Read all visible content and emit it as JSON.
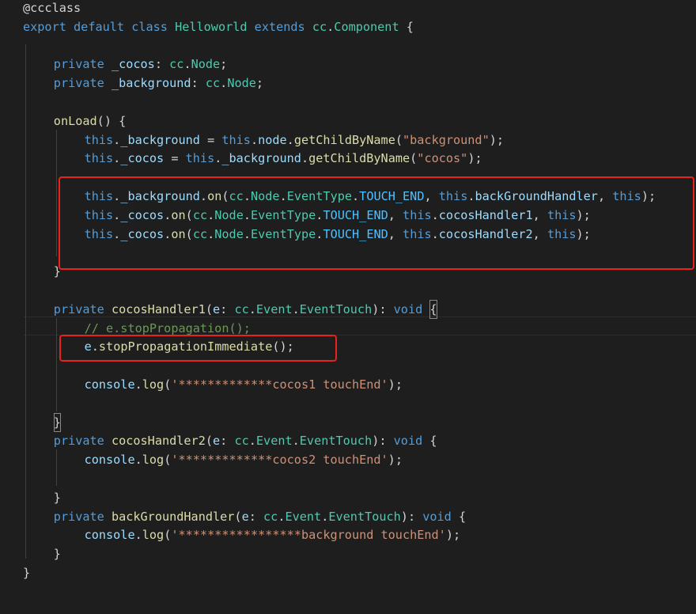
{
  "editor": {
    "lines": [
      {
        "indent": 0,
        "tokens": [
          [
            "@ccclass",
            "t-dec"
          ]
        ]
      },
      {
        "indent": 0,
        "tokens": [
          [
            "export",
            "t-kw"
          ],
          [
            " ",
            "t-punc"
          ],
          [
            "default",
            "t-kw"
          ],
          [
            " ",
            "t-punc"
          ],
          [
            "class",
            "t-kw"
          ],
          [
            " ",
            "t-punc"
          ],
          [
            "Helloworld",
            "t-cls"
          ],
          [
            " ",
            "t-punc"
          ],
          [
            "extends",
            "t-kw"
          ],
          [
            " ",
            "t-punc"
          ],
          [
            "cc",
            "t-cls"
          ],
          [
            ".",
            "t-punc"
          ],
          [
            "Component",
            "t-cls"
          ],
          [
            " {",
            "t-punc"
          ]
        ]
      },
      {
        "indent": 0,
        "tokens": []
      },
      {
        "indent": 1,
        "tokens": [
          [
            "private",
            "t-kw"
          ],
          [
            " ",
            "t-punc"
          ],
          [
            "_cocos",
            "t-prop"
          ],
          [
            ": ",
            "t-punc"
          ],
          [
            "cc",
            "t-cls"
          ],
          [
            ".",
            "t-punc"
          ],
          [
            "Node",
            "t-cls"
          ],
          [
            ";",
            "t-punc"
          ]
        ]
      },
      {
        "indent": 1,
        "tokens": [
          [
            "private",
            "t-kw"
          ],
          [
            " ",
            "t-punc"
          ],
          [
            "_background",
            "t-prop"
          ],
          [
            ": ",
            "t-punc"
          ],
          [
            "cc",
            "t-cls"
          ],
          [
            ".",
            "t-punc"
          ],
          [
            "Node",
            "t-cls"
          ],
          [
            ";",
            "t-punc"
          ]
        ]
      },
      {
        "indent": 0,
        "tokens": []
      },
      {
        "indent": 1,
        "tokens": [
          [
            "onLoad",
            "t-fn"
          ],
          [
            "() {",
            "t-punc"
          ]
        ]
      },
      {
        "indent": 2,
        "tokens": [
          [
            "this",
            "t-kw"
          ],
          [
            ".",
            "t-punc"
          ],
          [
            "_background",
            "t-prop"
          ],
          [
            " = ",
            "t-punc"
          ],
          [
            "this",
            "t-kw"
          ],
          [
            ".",
            "t-punc"
          ],
          [
            "node",
            "t-prop"
          ],
          [
            ".",
            "t-punc"
          ],
          [
            "getChildByName",
            "t-fn"
          ],
          [
            "(",
            "t-punc"
          ],
          [
            "\"background\"",
            "t-str"
          ],
          [
            ");",
            "t-punc"
          ]
        ]
      },
      {
        "indent": 2,
        "tokens": [
          [
            "this",
            "t-kw"
          ],
          [
            ".",
            "t-punc"
          ],
          [
            "_cocos",
            "t-prop"
          ],
          [
            " = ",
            "t-punc"
          ],
          [
            "this",
            "t-kw"
          ],
          [
            ".",
            "t-punc"
          ],
          [
            "_background",
            "t-prop"
          ],
          [
            ".",
            "t-punc"
          ],
          [
            "getChildByName",
            "t-fn"
          ],
          [
            "(",
            "t-punc"
          ],
          [
            "\"cocos\"",
            "t-str"
          ],
          [
            ");",
            "t-punc"
          ]
        ]
      },
      {
        "indent": 0,
        "tokens": []
      },
      {
        "indent": 2,
        "tokens": [
          [
            "this",
            "t-kw"
          ],
          [
            ".",
            "t-punc"
          ],
          [
            "_background",
            "t-prop"
          ],
          [
            ".",
            "t-punc"
          ],
          [
            "on",
            "t-fn"
          ],
          [
            "(",
            "t-punc"
          ],
          [
            "cc",
            "t-cls"
          ],
          [
            ".",
            "t-punc"
          ],
          [
            "Node",
            "t-cls"
          ],
          [
            ".",
            "t-punc"
          ],
          [
            "EventType",
            "t-cls"
          ],
          [
            ".",
            "t-punc"
          ],
          [
            "TOUCH_END",
            "t-const"
          ],
          [
            ", ",
            "t-punc"
          ],
          [
            "this",
            "t-kw"
          ],
          [
            ".",
            "t-punc"
          ],
          [
            "backGroundHandler",
            "t-prop"
          ],
          [
            ", ",
            "t-punc"
          ],
          [
            "this",
            "t-kw"
          ],
          [
            ");",
            "t-punc"
          ]
        ]
      },
      {
        "indent": 2,
        "tokens": [
          [
            "this",
            "t-kw"
          ],
          [
            ".",
            "t-punc"
          ],
          [
            "_cocos",
            "t-prop"
          ],
          [
            ".",
            "t-punc"
          ],
          [
            "on",
            "t-fn"
          ],
          [
            "(",
            "t-punc"
          ],
          [
            "cc",
            "t-cls"
          ],
          [
            ".",
            "t-punc"
          ],
          [
            "Node",
            "t-cls"
          ],
          [
            ".",
            "t-punc"
          ],
          [
            "EventType",
            "t-cls"
          ],
          [
            ".",
            "t-punc"
          ],
          [
            "TOUCH_END",
            "t-const"
          ],
          [
            ", ",
            "t-punc"
          ],
          [
            "this",
            "t-kw"
          ],
          [
            ".",
            "t-punc"
          ],
          [
            "cocosHandler1",
            "t-prop"
          ],
          [
            ", ",
            "t-punc"
          ],
          [
            "this",
            "t-kw"
          ],
          [
            ");",
            "t-punc"
          ]
        ]
      },
      {
        "indent": 2,
        "tokens": [
          [
            "this",
            "t-kw"
          ],
          [
            ".",
            "t-punc"
          ],
          [
            "_cocos",
            "t-prop"
          ],
          [
            ".",
            "t-punc"
          ],
          [
            "on",
            "t-fn"
          ],
          [
            "(",
            "t-punc"
          ],
          [
            "cc",
            "t-cls"
          ],
          [
            ".",
            "t-punc"
          ],
          [
            "Node",
            "t-cls"
          ],
          [
            ".",
            "t-punc"
          ],
          [
            "EventType",
            "t-cls"
          ],
          [
            ".",
            "t-punc"
          ],
          [
            "TOUCH_END",
            "t-const"
          ],
          [
            ", ",
            "t-punc"
          ],
          [
            "this",
            "t-kw"
          ],
          [
            ".",
            "t-punc"
          ],
          [
            "cocosHandler2",
            "t-prop"
          ],
          [
            ", ",
            "t-punc"
          ],
          [
            "this",
            "t-kw"
          ],
          [
            ");",
            "t-punc"
          ]
        ]
      },
      {
        "indent": 0,
        "tokens": []
      },
      {
        "indent": 1,
        "tokens": [
          [
            "}",
            "t-punc"
          ]
        ]
      },
      {
        "indent": 0,
        "tokens": []
      },
      {
        "indent": 1,
        "tokens": [
          [
            "private",
            "t-kw"
          ],
          [
            " ",
            "t-punc"
          ],
          [
            "cocosHandler1",
            "t-fn"
          ],
          [
            "(",
            "t-punc"
          ],
          [
            "e",
            "t-prop"
          ],
          [
            ": ",
            "t-punc"
          ],
          [
            "cc",
            "t-cls"
          ],
          [
            ".",
            "t-punc"
          ],
          [
            "Event",
            "t-cls"
          ],
          [
            ".",
            "t-punc"
          ],
          [
            "EventTouch",
            "t-cls"
          ],
          [
            "): ",
            "t-punc"
          ],
          [
            "void",
            "t-kw"
          ],
          [
            " ",
            "t-punc"
          ],
          [
            "{",
            "t-punc box"
          ]
        ]
      },
      {
        "indent": 2,
        "tokens": [
          [
            "// e.stopPropagation();",
            "t-cm"
          ]
        ]
      },
      {
        "indent": 2,
        "tokens": [
          [
            "e",
            "t-prop"
          ],
          [
            ".",
            "t-punc"
          ],
          [
            "stopPropagationImmediate",
            "t-fn"
          ],
          [
            "();",
            "t-punc"
          ]
        ]
      },
      {
        "indent": 0,
        "tokens": []
      },
      {
        "indent": 2,
        "tokens": [
          [
            "console",
            "t-prop"
          ],
          [
            ".",
            "t-punc"
          ],
          [
            "log",
            "t-fn"
          ],
          [
            "(",
            "t-punc"
          ],
          [
            "'*************cocos1 touchEnd'",
            "t-str"
          ],
          [
            ");",
            "t-punc"
          ]
        ]
      },
      {
        "indent": 0,
        "tokens": []
      },
      {
        "indent": 1,
        "tokens": [
          [
            "}",
            "t-punc box"
          ]
        ]
      },
      {
        "indent": 1,
        "tokens": [
          [
            "private",
            "t-kw"
          ],
          [
            " ",
            "t-punc"
          ],
          [
            "cocosHandler2",
            "t-fn"
          ],
          [
            "(",
            "t-punc"
          ],
          [
            "e",
            "t-prop"
          ],
          [
            ": ",
            "t-punc"
          ],
          [
            "cc",
            "t-cls"
          ],
          [
            ".",
            "t-punc"
          ],
          [
            "Event",
            "t-cls"
          ],
          [
            ".",
            "t-punc"
          ],
          [
            "EventTouch",
            "t-cls"
          ],
          [
            "): ",
            "t-punc"
          ],
          [
            "void",
            "t-kw"
          ],
          [
            " {",
            "t-punc"
          ]
        ]
      },
      {
        "indent": 2,
        "tokens": [
          [
            "console",
            "t-prop"
          ],
          [
            ".",
            "t-punc"
          ],
          [
            "log",
            "t-fn"
          ],
          [
            "(",
            "t-punc"
          ],
          [
            "'*************cocos2 touchEnd'",
            "t-str"
          ],
          [
            ");",
            "t-punc"
          ]
        ]
      },
      {
        "indent": 0,
        "tokens": []
      },
      {
        "indent": 1,
        "tokens": [
          [
            "}",
            "t-punc"
          ]
        ]
      },
      {
        "indent": 1,
        "tokens": [
          [
            "private",
            "t-kw"
          ],
          [
            " ",
            "t-punc"
          ],
          [
            "backGroundHandler",
            "t-fn"
          ],
          [
            "(",
            "t-punc"
          ],
          [
            "e",
            "t-prop"
          ],
          [
            ": ",
            "t-punc"
          ],
          [
            "cc",
            "t-cls"
          ],
          [
            ".",
            "t-punc"
          ],
          [
            "Event",
            "t-cls"
          ],
          [
            ".",
            "t-punc"
          ],
          [
            "EventTouch",
            "t-cls"
          ],
          [
            "): ",
            "t-punc"
          ],
          [
            "void",
            "t-kw"
          ],
          [
            " {",
            "t-punc"
          ]
        ]
      },
      {
        "indent": 2,
        "tokens": [
          [
            "console",
            "t-prop"
          ],
          [
            ".",
            "t-punc"
          ],
          [
            "log",
            "t-fn"
          ],
          [
            "(",
            "t-punc"
          ],
          [
            "'*****************background touchEnd'",
            "t-str"
          ],
          [
            ");",
            "t-punc"
          ]
        ]
      },
      {
        "indent": 1,
        "tokens": [
          [
            "}",
            "t-punc"
          ]
        ]
      },
      {
        "indent": 0,
        "tokens": [
          [
            "}",
            "t-punc"
          ]
        ]
      }
    ]
  }
}
